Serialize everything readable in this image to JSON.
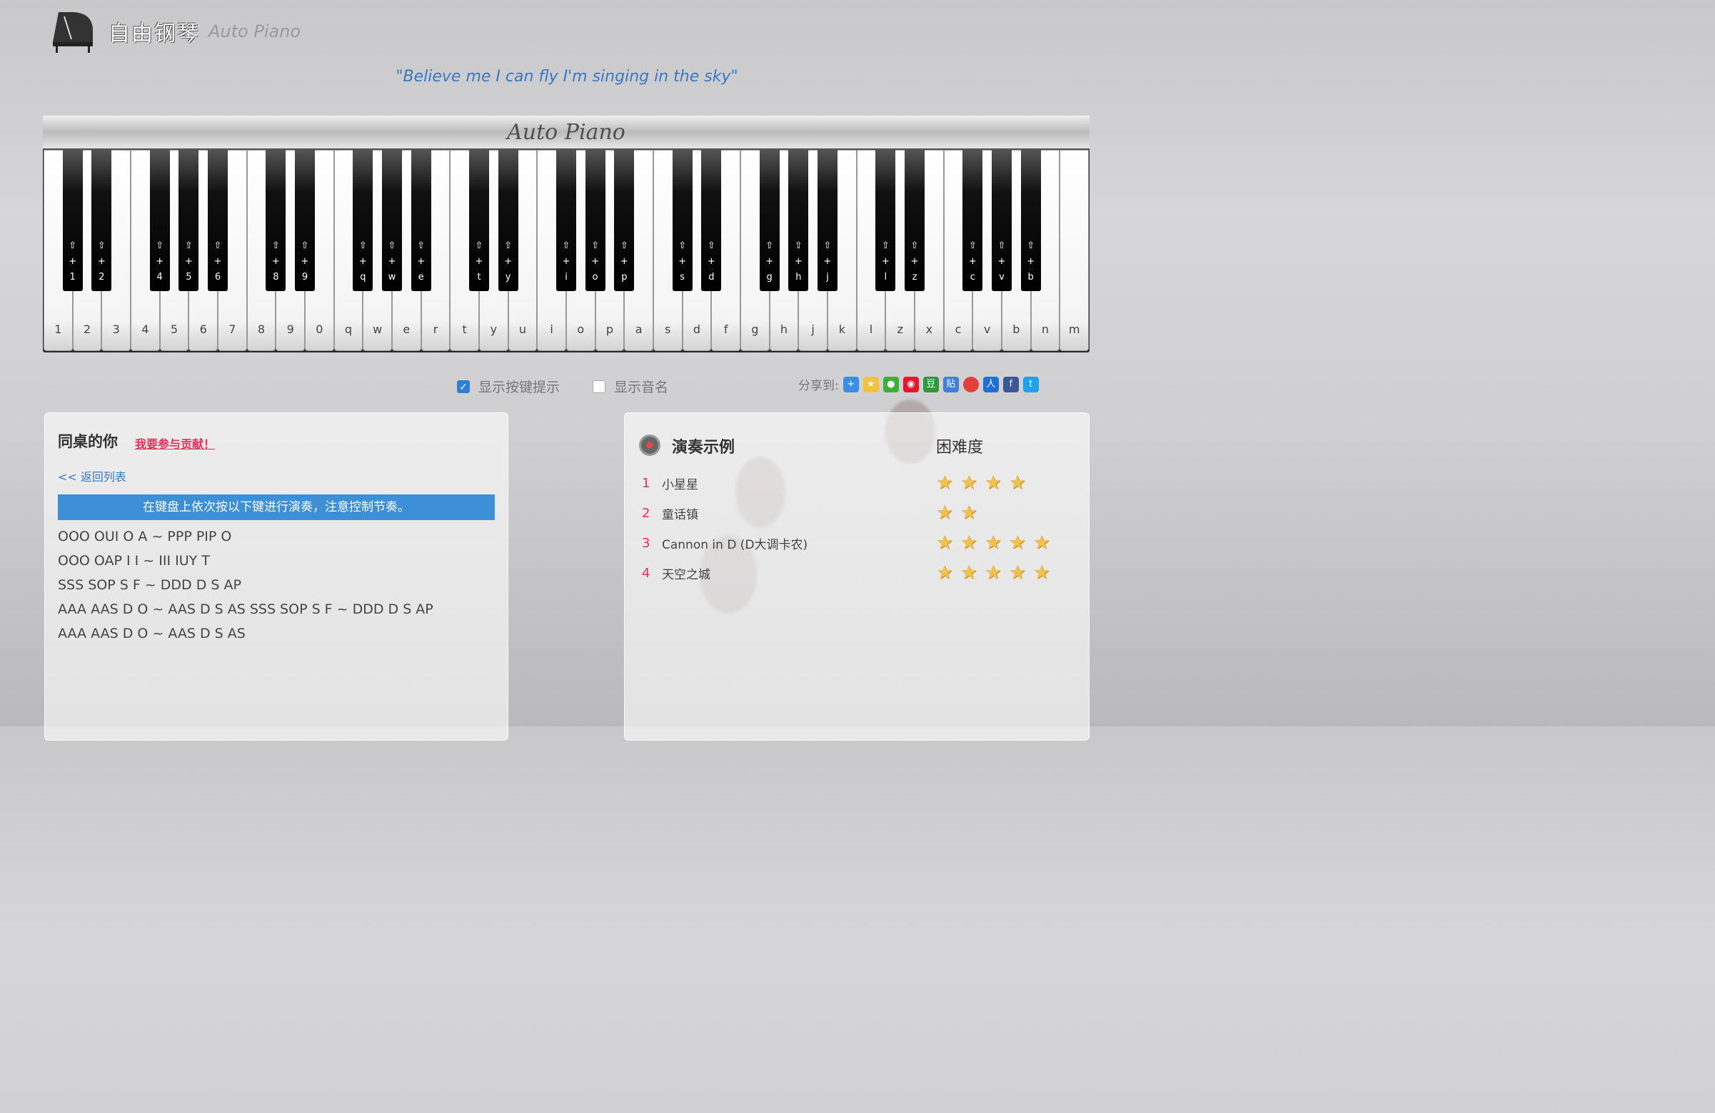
{
  "header": {
    "title_cn": "自由钢琴",
    "title_en": "Auto Piano"
  },
  "quote": "\"Believe me I can fly I'm singing in the sky\"",
  "piano": {
    "brand": "Auto Piano",
    "white_keys": [
      "1",
      "2",
      "3",
      "4",
      "5",
      "6",
      "7",
      "8",
      "9",
      "0",
      "q",
      "w",
      "e",
      "r",
      "t",
      "y",
      "u",
      "i",
      "o",
      "p",
      "a",
      "s",
      "d",
      "f",
      "g",
      "h",
      "j",
      "k",
      "l",
      "z",
      "x",
      "c",
      "v",
      "b",
      "n",
      "m"
    ],
    "black_keys": [
      "1",
      "2",
      "4",
      "5",
      "6",
      "8",
      "9",
      "q",
      "w",
      "e",
      "t",
      "y",
      "i",
      "o",
      "p",
      "s",
      "d",
      "g",
      "h",
      "j",
      "l",
      "z",
      "c",
      "v",
      "b"
    ]
  },
  "options": {
    "show_keys": "显示按键提示",
    "show_names": "显示音名",
    "share": "分享到:"
  },
  "song": {
    "title": "同桌的你",
    "contribute": "我要参与贡献！",
    "back": "<< 返回列表",
    "tip": "在键盘上依次按以下键进行演奏，注意控制节奏。",
    "lines": [
      "OOO OUI O A ~ PPP PIP O",
      "OOO OAP I I ~ III IUY T",
      "SSS SOP S F ~ DDD D S AP",
      "AAA AAS D O ~ AAS D S AS SSS SOP S F ~ DDD D S AP",
      "AAA AAS D O ~ AAS D S AS"
    ]
  },
  "demo": {
    "title": "演奏示例",
    "difficulty": "困难度",
    "items": [
      {
        "num": "1",
        "name": "小星星",
        "stars": 4
      },
      {
        "num": "2",
        "name": "童话镇",
        "stars": 2
      },
      {
        "num": "3",
        "name": "Cannon in D (D大调卡农)",
        "stars": 5
      },
      {
        "num": "4",
        "name": "天空之城",
        "stars": 5
      }
    ]
  },
  "colors": {
    "accent": "#3d8fd6",
    "link_red": "#e0325a",
    "star": "#f2c14e"
  }
}
